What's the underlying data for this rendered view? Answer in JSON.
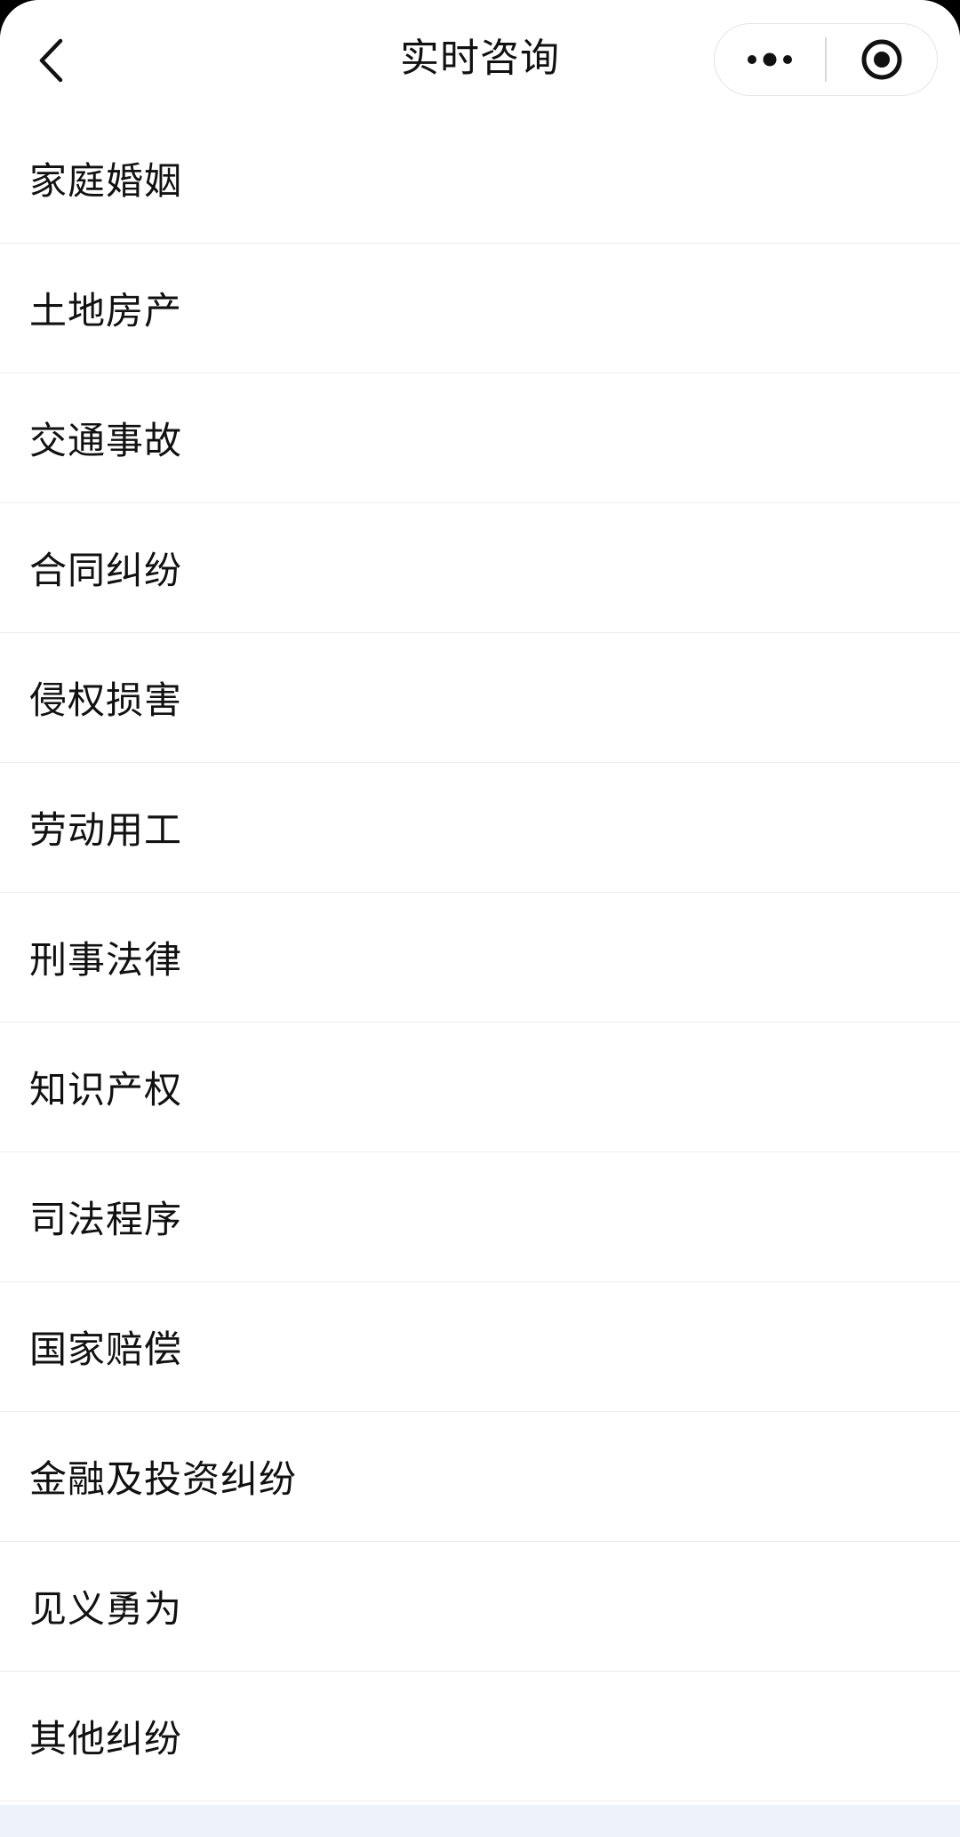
{
  "nav": {
    "title": "实时咨询",
    "back_icon": "chevron-left-icon",
    "more_icon": "more-dots-icon",
    "close_icon": "target-close-icon"
  },
  "categories": [
    {
      "label": "家庭婚姻"
    },
    {
      "label": "土地房产"
    },
    {
      "label": "交通事故"
    },
    {
      "label": "合同纠纷"
    },
    {
      "label": "侵权损害"
    },
    {
      "label": "劳动用工"
    },
    {
      "label": "刑事法律"
    },
    {
      "label": "知识产权"
    },
    {
      "label": "司法程序"
    },
    {
      "label": "国家赔偿"
    },
    {
      "label": "金融及投资纠纷"
    },
    {
      "label": "见义勇为"
    },
    {
      "label": "其他纠纷"
    }
  ],
  "colors": {
    "text": "#111111",
    "divider": "#ececec",
    "footer": "#eef3fa"
  }
}
